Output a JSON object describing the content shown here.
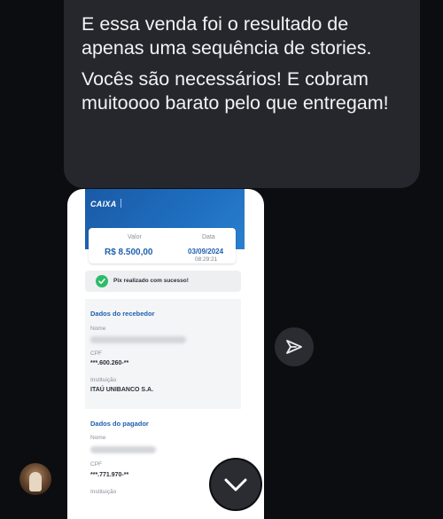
{
  "message": {
    "paragraphs": [
      "E essa venda foi o resultado de apenas uma sequência de stories.",
      "Vocês são necessários! E cobram muitoooo barato pelo que entregam!"
    ]
  },
  "receipt": {
    "bank_logo": "CAIXA",
    "value_label": "Valor",
    "value": "R$ 8.500,00",
    "date_label": "Data",
    "date": "03/09/2024",
    "time": "08:29:21",
    "success_text": "Pix realizado com sucesso!",
    "receiver": {
      "section_title": "Dados do recebedor",
      "name_label": "Nome",
      "cpf_label": "CPF",
      "cpf": "***.600.260-**",
      "institution_label": "Instituição",
      "institution": "ITAÚ UNIBANCO S.A."
    },
    "payer": {
      "section_title": "Dados do pagador",
      "name_label": "Nome",
      "cpf_label": "CPF",
      "cpf": "***.771.970-**",
      "institution_label": "Instituição"
    }
  },
  "icons": {
    "send": "send-icon",
    "scroll": "chevron-down-icon",
    "success": "check-circle-icon"
  },
  "colors": {
    "background": "#0c0d11",
    "bubble": "#25272d",
    "caixa_blue": "#1f5fae",
    "success_green": "#2dbb6a"
  }
}
